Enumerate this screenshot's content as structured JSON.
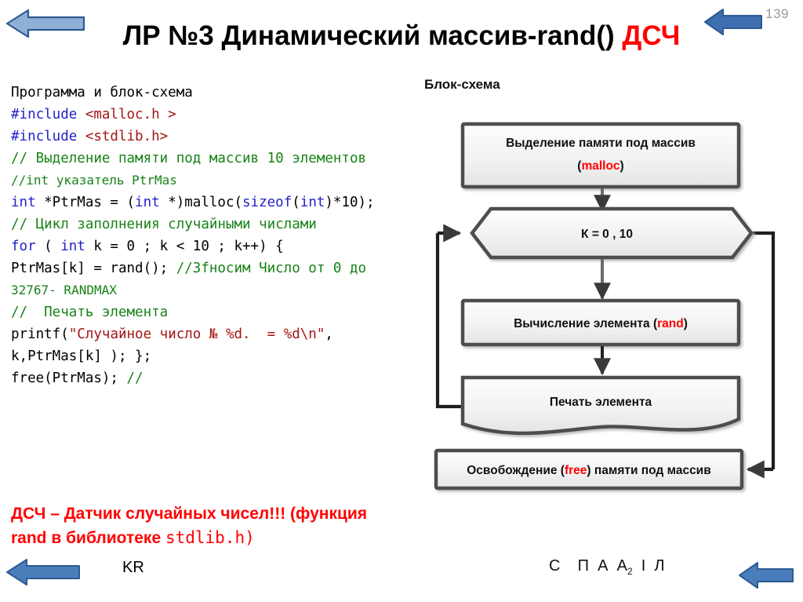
{
  "slide": {
    "page_number": "139",
    "title_main": "ЛР №3 Динамический массив-rand() ",
    "title_accent": "ДСЧ",
    "accent_color": "#ff0000"
  },
  "nav": {
    "top_left_arrow": "previous-slide-arrow",
    "top_right_arrow": "next-slide-arrow",
    "bottom_left_arrow": "previous-slide-arrow",
    "bottom_right_arrow": "next-slide-arrow",
    "arrow_fill_light": "#8fb0d6",
    "arrow_fill_dark": "#4a7ebb",
    "arrow_stroke": "#2d5a92"
  },
  "code_panel": {
    "caption": "Программа и блок-схема",
    "lines": [
      {
        "id": "l1",
        "segments": [
          {
            "t": "#include ",
            "c": "pre"
          },
          {
            "t": "<malloc.h >",
            "c": "inc"
          }
        ]
      },
      {
        "id": "l2",
        "segments": [
          {
            "t": "#include ",
            "c": "pre"
          },
          {
            "t": "<stdlib.h>",
            "c": "inc"
          }
        ]
      },
      {
        "id": "l3",
        "segments": [
          {
            "t": "// Выделение памяти под массив 10 элементов",
            "c": "com"
          }
        ]
      },
      {
        "id": "l4",
        "segments": [
          {
            "t": "//int указатель PtrMas",
            "c": "com"
          }
        ],
        "small": true
      },
      {
        "id": "l5",
        "segments": [
          {
            "t": "int",
            "c": "kw"
          },
          {
            "t": " *PtrMas = (",
            "c": "plain"
          },
          {
            "t": "int",
            "c": "kw"
          },
          {
            "t": " *)malloc(",
            "c": "plain"
          },
          {
            "t": "sizeof",
            "c": "kw"
          },
          {
            "t": "(",
            "c": "plain"
          },
          {
            "t": "int",
            "c": "kw"
          },
          {
            "t": ")*10);",
            "c": "plain"
          }
        ]
      },
      {
        "id": "l6",
        "segments": [
          {
            "t": "// Цикл заполнения случайными числами",
            "c": "com"
          }
        ]
      },
      {
        "id": "l7",
        "segments": [
          {
            "t": "for",
            "c": "kw"
          },
          {
            "t": " ( ",
            "c": "plain"
          },
          {
            "t": "int",
            "c": "kw"
          },
          {
            "t": " k = 0 ; k < 10 ; k++) {",
            "c": "plain"
          }
        ]
      },
      {
        "id": "l8",
        "segments": [
          {
            "t": "PtrMas[k] = rand(); ",
            "c": "plain"
          },
          {
            "t": "//Зfносим Число от 0 до",
            "c": "com"
          }
        ]
      },
      {
        "id": "l9",
        "segments": [
          {
            "t": "32767- RANDMAX",
            "c": "com"
          }
        ],
        "small": true
      },
      {
        "id": "l10",
        "segments": [
          {
            "t": "//  Печать элемента",
            "c": "com"
          }
        ]
      },
      {
        "id": "l11",
        "segments": [
          {
            "t": "printf(",
            "c": "plain"
          },
          {
            "t": "\"Случайное число № %d.  = %d\\n\"",
            "c": "str"
          },
          {
            "t": ",",
            "c": "plain"
          }
        ]
      },
      {
        "id": "l12",
        "segments": [
          {
            "t": "k,PtrMas[k] ); };",
            "c": "plain"
          }
        ]
      },
      {
        "id": "l13",
        "segments": [
          {
            "t": "free(PtrMas); ",
            "c": "plain"
          },
          {
            "t": "//",
            "c": "com"
          }
        ]
      }
    ]
  },
  "note": {
    "line1": "ДСЧ – Датчик случайных чисел!!! (функция",
    "line2_a": "rand в библиотеке ",
    "line2_mono": "stdlib.h",
    "line2_b": ")"
  },
  "footer": {
    "kr": "KR",
    "letters_pre": "С    П  А  А",
    "letters_sub": "2",
    "letters_post": "  І  Л"
  },
  "flowchart": {
    "label": "Блок-схема",
    "nodes": [
      {
        "id": "alloc",
        "shape": "process",
        "line1": "Выделение памяти под массив",
        "line2_open": "(",
        "line2_accent": "malloc",
        "line2_close": ")"
      },
      {
        "id": "loop",
        "shape": "hexagon",
        "line1": "К = 0 , 10"
      },
      {
        "id": "calc",
        "shape": "process",
        "line1_a": "Вычисление элемента (",
        "line1_accent": "rand",
        "line1_b": ")"
      },
      {
        "id": "print",
        "shape": "document",
        "line1": "Печать элемента"
      },
      {
        "id": "free",
        "shape": "process",
        "line1_a": "Освобождение (",
        "line1_accent": "free",
        "line1_b": ") памяти под массив"
      }
    ],
    "edges": [
      {
        "from": "alloc",
        "to": "loop",
        "kind": "down-arrow"
      },
      {
        "from": "loop",
        "to": "calc",
        "kind": "down-arrow"
      },
      {
        "from": "calc",
        "to": "print",
        "kind": "down-arrow"
      },
      {
        "from": "print",
        "to": "loop",
        "kind": "left-feedback"
      },
      {
        "from": "loop",
        "to": "free",
        "kind": "right-exit"
      }
    ],
    "node_fill_top": "#fdfdfd",
    "node_fill_bottom": "#e6e6e6",
    "node_stroke": "#4d4d4d",
    "accent_color": "#ff0000"
  }
}
